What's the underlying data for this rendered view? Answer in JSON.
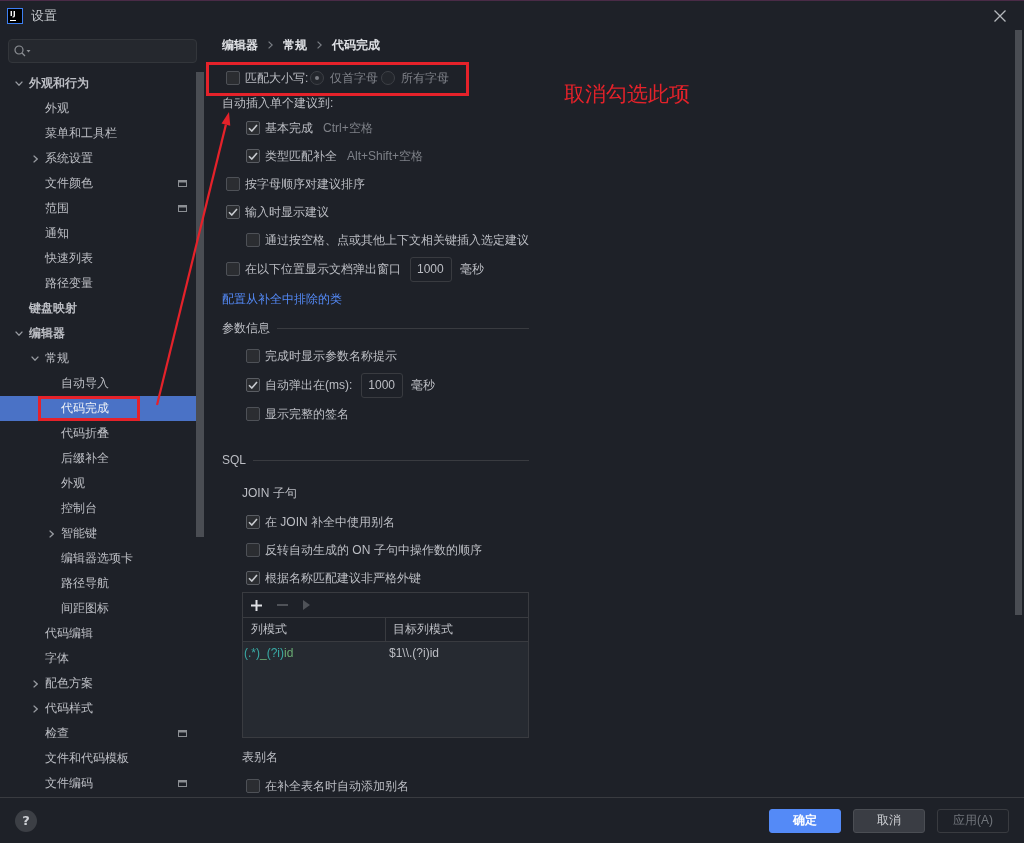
{
  "window": {
    "logo": "IJ",
    "title": "设置"
  },
  "sidebar": {
    "tree": [
      {
        "label": "外观和行为",
        "expanded": true,
        "selected": false,
        "project_icon": false,
        "children": [
          {
            "label": "外观",
            "selected": false,
            "project_icon": false
          },
          {
            "label": "菜单和工具栏",
            "selected": false,
            "project_icon": false
          },
          {
            "label": "系统设置",
            "expanded": false,
            "selected": false,
            "project_icon": false
          },
          {
            "label": "文件颜色",
            "selected": false,
            "project_icon": true
          },
          {
            "label": "范围",
            "selected": false,
            "project_icon": true
          },
          {
            "label": "通知",
            "selected": false,
            "project_icon": false
          },
          {
            "label": "快速列表",
            "selected": false,
            "project_icon": false
          },
          {
            "label": "路径变量",
            "selected": false,
            "project_icon": false
          }
        ]
      },
      {
        "label": "键盘映射",
        "selected": false,
        "project_icon": false
      },
      {
        "label": "编辑器",
        "expanded": true,
        "selected": false,
        "project_icon": false,
        "children": [
          {
            "label": "常规",
            "expanded": true,
            "selected": false,
            "project_icon": false,
            "children": [
              {
                "label": "自动导入",
                "selected": false,
                "project_icon": false
              },
              {
                "label": "代码完成",
                "selected": true,
                "project_icon": false
              },
              {
                "label": "代码折叠",
                "selected": false,
                "project_icon": false
              },
              {
                "label": "后缀补全",
                "selected": false,
                "project_icon": false
              },
              {
                "label": "外观",
                "selected": false,
                "project_icon": false
              },
              {
                "label": "控制台",
                "selected": false,
                "project_icon": false
              },
              {
                "label": "智能键",
                "expanded": false,
                "selected": false,
                "project_icon": false
              },
              {
                "label": "编辑器选项卡",
                "selected": false,
                "project_icon": false
              },
              {
                "label": "路径导航",
                "selected": false,
                "project_icon": false
              },
              {
                "label": "间距图标",
                "selected": false,
                "project_icon": false
              }
            ]
          },
          {
            "label": "代码编辑",
            "selected": false,
            "project_icon": false
          },
          {
            "label": "字体",
            "selected": false,
            "project_icon": false
          },
          {
            "label": "配色方案",
            "expanded": false,
            "selected": false,
            "project_icon": false
          },
          {
            "label": "代码样式",
            "expanded": false,
            "selected": false,
            "project_icon": false
          },
          {
            "label": "检查",
            "selected": false,
            "project_icon": true
          },
          {
            "label": "文件和代码模板",
            "selected": false,
            "project_icon": false
          },
          {
            "label": "文件编码",
            "selected": false,
            "project_icon": true
          }
        ]
      }
    ]
  },
  "main": {
    "breadcrumb": [
      "编辑器",
      "常规",
      "代码完成"
    ],
    "options": [
      {
        "kind": "checkbox",
        "label": "匹配大小写:",
        "checked": false,
        "radios": [
          {
            "label": "仅首字母",
            "selected": true,
            "disabled": true
          },
          {
            "label": "所有字母",
            "selected": false,
            "disabled": true
          }
        ]
      },
      {
        "kind": "label",
        "label": "自动插入单个建议到:",
        "children": [
          {
            "kind": "checkbox",
            "label": "基本完成",
            "checked": true,
            "shortcut": "Ctrl+空格"
          },
          {
            "kind": "checkbox",
            "label": "类型匹配补全",
            "checked": true,
            "shortcut": "Alt+Shift+空格"
          }
        ]
      },
      {
        "kind": "checkbox",
        "label": "按字母顺序对建议排序",
        "checked": false
      },
      {
        "kind": "checkbox",
        "label": "输入时显示建议",
        "checked": true,
        "children": [
          {
            "kind": "checkbox",
            "label": "通过按空格、点或其他上下文相关键插入选定建议",
            "checked": false
          }
        ]
      },
      {
        "kind": "checkbox",
        "label": "在以下位置显示文档弹出窗口",
        "checked": false,
        "value": "1000",
        "unit": "毫秒"
      },
      {
        "kind": "link",
        "label": "配置从补全中排除的类"
      },
      {
        "kind": "section",
        "label": "参数信息",
        "children": [
          {
            "kind": "checkbox",
            "label": "完成时显示参数名称提示",
            "checked": false
          },
          {
            "kind": "checkbox",
            "label": "自动弹出在(ms):",
            "checked": true,
            "value": "1000",
            "unit": "毫秒"
          },
          {
            "kind": "checkbox",
            "label": "显示完整的签名",
            "checked": false
          }
        ]
      },
      {
        "kind": "section",
        "label": "SQL",
        "children": [
          {
            "kind": "subsection",
            "label": "JOIN 子句",
            "children": [
              {
                "kind": "checkbox",
                "label": "在 JOIN 补全中使用别名",
                "checked": true
              },
              {
                "kind": "checkbox",
                "label": "反转自动生成的 ON 子句中操作数的顺序",
                "checked": false
              },
              {
                "kind": "checkbox",
                "label": "根据名称匹配建议非严格外键",
                "checked": true
              },
              {
                "kind": "table",
                "toolbar": [
                  {
                    "kind": "add",
                    "disabled": false
                  },
                  {
                    "kind": "remove",
                    "disabled": true
                  },
                  {
                    "kind": "move",
                    "disabled": true
                  }
                ],
                "columns": [
                  "列模式",
                  "目标列模式"
                ],
                "rows": [
                  {
                    "cells": [
                      {
                        "parts": [
                          {
                            "text": "(.*)",
                            "kind": "group"
                          },
                          {
                            "text": "_",
                            "kind": "literal"
                          },
                          {
                            "text": "(?i)",
                            "kind": "group"
                          },
                          {
                            "text": "id",
                            "kind": "literal"
                          }
                        ]
                      },
                      {
                        "parts": [
                          {
                            "text": "$1\\\\.(?i)id",
                            "kind": "plain"
                          }
                        ]
                      }
                    ]
                  }
                ]
              }
            ]
          },
          {
            "kind": "subsection",
            "label": "表别名",
            "children": [
              {
                "kind": "checkbox",
                "label": "在补全表名时自动添加别名",
                "checked": false
              }
            ]
          }
        ]
      }
    ]
  },
  "annotation": {
    "note": "取消勾选此项"
  },
  "footer": {
    "help": "?",
    "buttons": [
      {
        "label": "确定",
        "kind": "primary",
        "disabled": false
      },
      {
        "label": "取消",
        "kind": "secondary",
        "disabled": false
      },
      {
        "label": "应用(A)",
        "kind": "secondary",
        "disabled": true
      }
    ]
  }
}
